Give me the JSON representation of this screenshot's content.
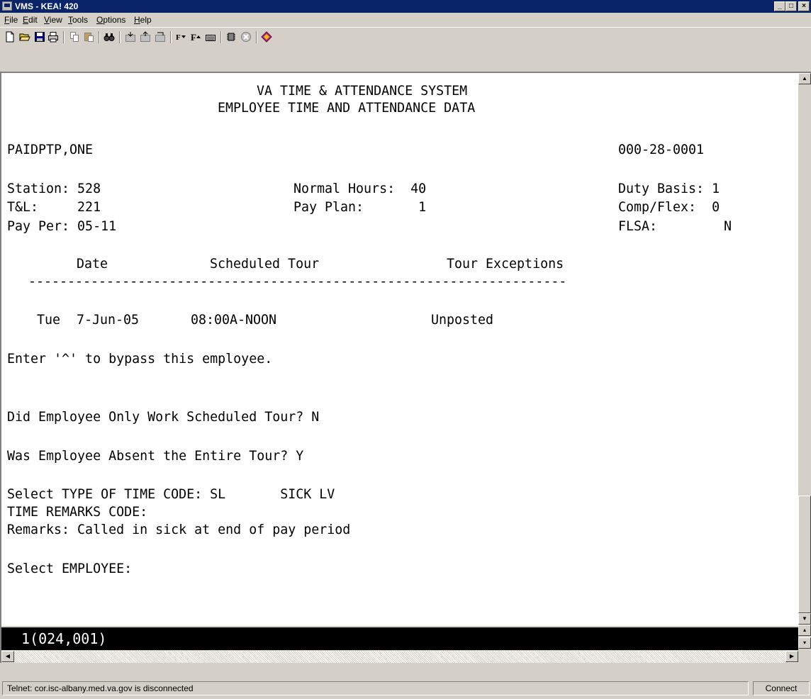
{
  "window": {
    "title": "VMS - KEA! 420",
    "controls": {
      "minimize": "_",
      "maximize": "□",
      "close": "×"
    }
  },
  "menu": {
    "items": [
      {
        "mnemonic": "F",
        "rest": "ile"
      },
      {
        "mnemonic": "E",
        "rest": "dit"
      },
      {
        "mnemonic": "V",
        "rest": "iew"
      },
      {
        "mnemonic": "T",
        "rest": "ools"
      },
      {
        "mnemonic": "O",
        "rest": "ptions"
      },
      {
        "mnemonic": "H",
        "rest": "elp"
      }
    ]
  },
  "toolbar": {
    "icons": [
      "new-document-icon",
      "open-folder-icon",
      "save-icon",
      "print-icon",
      "copy-icon",
      "paste-icon",
      "binoculars-icon",
      "transfer-icon",
      "transfer-send-icon",
      "transfer-receive-icon",
      "font-decrease-icon",
      "font-increase-icon",
      "keyboard-icon",
      "chip-settings-icon",
      "disconnect-icon",
      "diamond-icon"
    ]
  },
  "terminal": {
    "header_line1": "VA TIME & ATTENDANCE SYSTEM",
    "header_line2": "EMPLOYEE TIME AND ATTENDANCE DATA",
    "employee_name": "PAIDPTP,ONE",
    "employee_ssn": "000-28-0001",
    "station": "Station: 528",
    "normal_hours": "Normal Hours:  40",
    "duty_basis": "Duty Basis: 1",
    "tl": "T&L:     221",
    "pay_plan": "Pay Plan:       1",
    "comp_flex": "Comp/Flex:  0",
    "pay_per": "Pay Per: 05-11",
    "flsa_label": "FLSA:",
    "flsa_value": "N",
    "col_date": "Date",
    "col_scheduled_tour": "Scheduled Tour",
    "col_tour_exceptions": "Tour Exceptions",
    "divider": "---------------------------------------------------------------------",
    "row_day": "Tue",
    "row_date": "7-Jun-05",
    "row_tour": "08:00A-NOON",
    "row_exception": "Unposted",
    "bypass_prompt": "Enter '^' to bypass this employee.",
    "q1": "Did Employee Only Work Scheduled Tour? N",
    "q2": "Was Employee Absent the Entire Tour? Y",
    "time_code": "Select TYPE OF TIME CODE: SL       SICK LV",
    "remarks_code": "TIME REMARKS CODE:",
    "remarks": "Remarks: Called in sick at end of pay period",
    "select_employee": "Select EMPLOYEE:"
  },
  "terminal_status": "1(024,001)",
  "statusbar": {
    "message": "Telnet: cor.isc-albany.med.va.gov is disconnected",
    "connect_label": "Connect"
  }
}
